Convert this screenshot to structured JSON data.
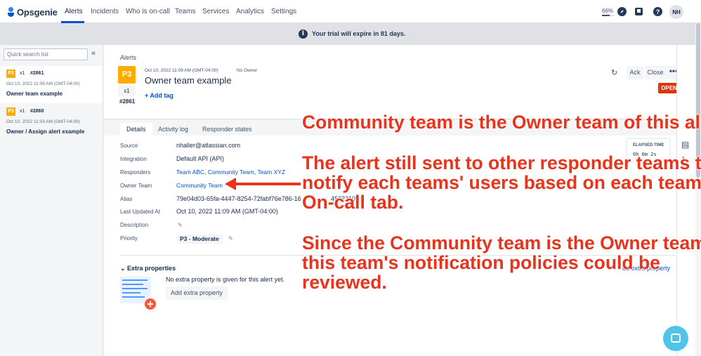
{
  "nav": {
    "logo": "Opsgenie",
    "items": [
      "Alerts",
      "Incidents",
      "Who is on-call",
      "Teams",
      "Services",
      "Analytics",
      "Settings"
    ],
    "zoom": "66%",
    "avatar": "NH"
  },
  "banner": {
    "text": "Your trial will expire in 81 days.",
    "icon": "info-icon"
  },
  "sidebar": {
    "search_placeholder": "Quick search list",
    "alerts": [
      {
        "priority": "P3",
        "count": "x1",
        "number": "#2861",
        "timestamp": "Oct 10, 2022 11:09 AM (GMT-04:00)",
        "title": "Owner team example"
      },
      {
        "priority": "P3",
        "count": "x1",
        "number": "#2860",
        "timestamp": "Oct 10, 2022 11:03 AM (GMT-04:00)",
        "title": "Owner / Assign alert example"
      }
    ]
  },
  "detail": {
    "breadcrumb": "Alerts",
    "priority": "P3",
    "count": "x1",
    "number": "#2861",
    "timestamp": "Oct 10, 2022 11:09 AM (GMT-04:00)",
    "owner": "No Owner",
    "title": "Owner team example",
    "add_tag": "+ Add tag",
    "ack_label": "Ack",
    "close_label": "Close",
    "more_label": "•••",
    "status": "OPEN",
    "tabs": [
      "Details",
      "Activity log",
      "Responder states"
    ],
    "fields": {
      "source_label": "Source",
      "source": "nhaller@atlassian.com",
      "integration_label": "Integration",
      "integration": "Default API (API)",
      "responders_label": "Responders",
      "responders": [
        "Team ABC",
        "Community Team",
        "Team XYZ"
      ],
      "owner_team_label": "Owner Team",
      "owner_team": "Community Team",
      "alias_label": "Alias",
      "alias": "79e04d03-65fa-4447-8254-72fabf76e786-16",
      "alias_tail": "4502210",
      "updated_label": "Last Updated At",
      "updated": "Oct 10, 2022 11:09 AM (GMT-04:00)",
      "description_label": "Description",
      "priority_label": "Priority",
      "priority": "P3 - Moderate"
    },
    "elapsed": {
      "label": "ELAPSED TIME",
      "value": "0h  0m  2s"
    },
    "extra": {
      "heading": "Extra properties",
      "empty": "No extra property is given for this alert yet.",
      "add_button": "Add extra property",
      "add_link": "dd extra property"
    }
  },
  "annotations": {
    "line1": "Community team is the Owner team of this alert.",
    "line2": "The alert still sent to other responder teams to\nnotify each teams' users based on each teams'\nOn-call tab.",
    "line3": "Since the Community team is the Owner team,\nthis team's notification policies could be\nreviewed.",
    "color": "#e8341c"
  },
  "colors": {
    "accent": "#0052cc",
    "priority_p3": "#ffab00",
    "open_status": "#de350b"
  }
}
